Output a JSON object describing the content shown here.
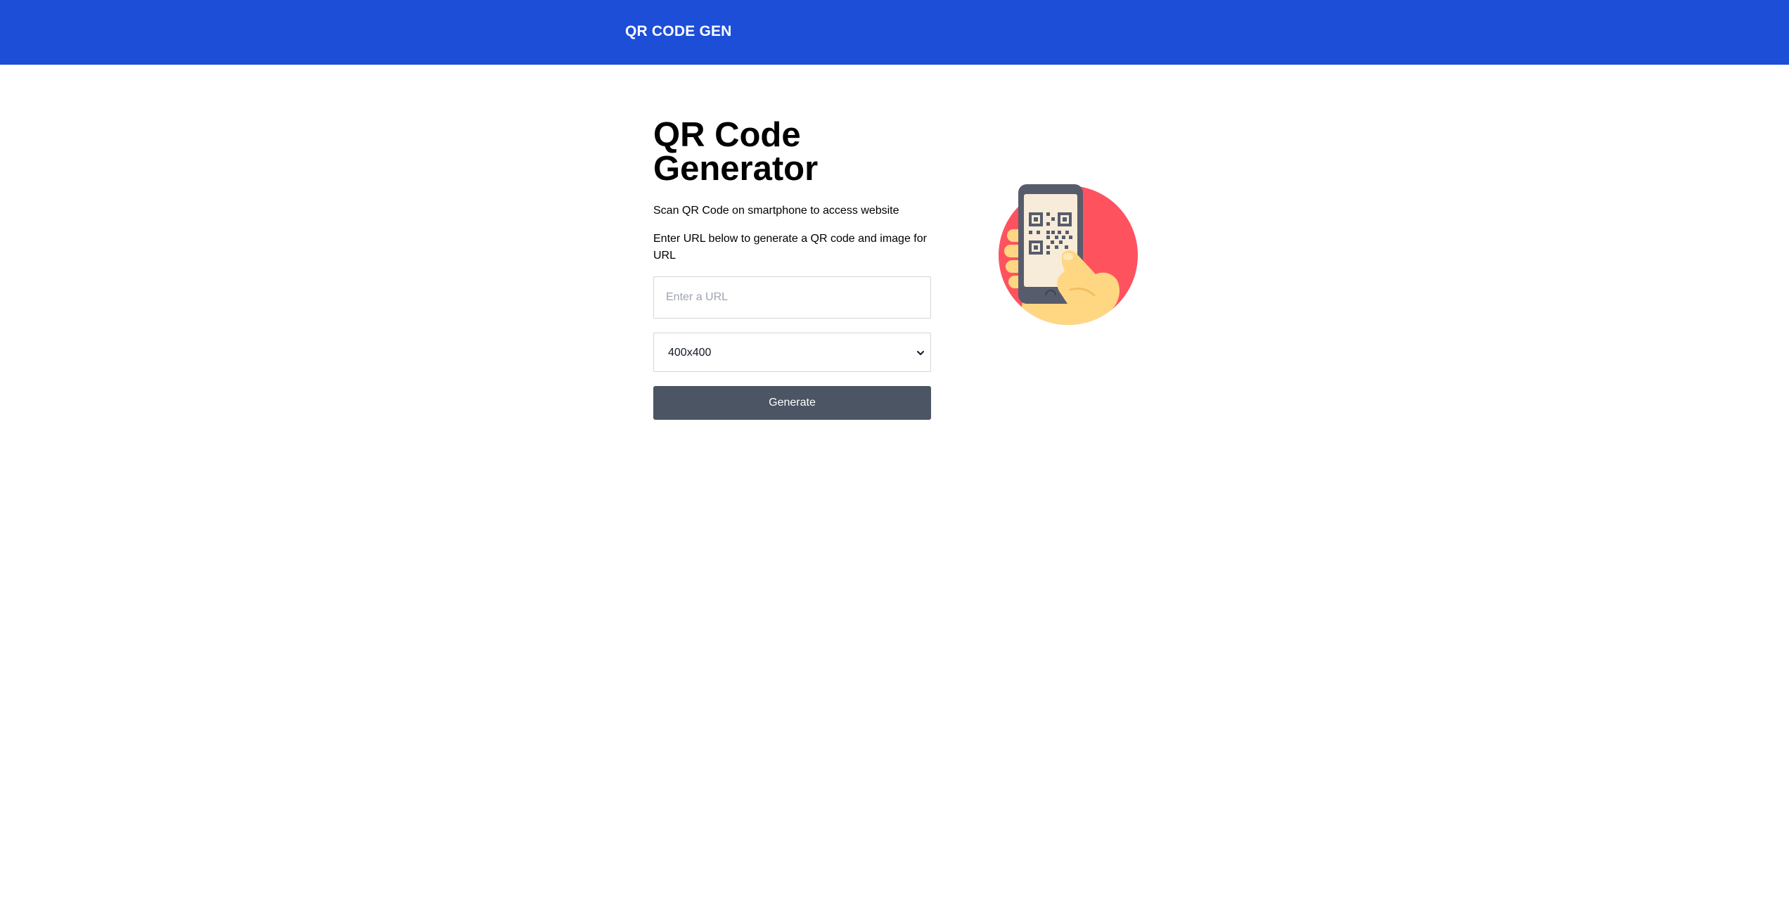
{
  "navbar": {
    "brand": "QR CODE GEN"
  },
  "main": {
    "title_line1": "QR Code",
    "title_line2": "Generator",
    "description_1": "Scan QR Code on smartphone to access website",
    "description_2_line1": "Enter URL below to generate a QR code and image for",
    "description_2_line2": "URL",
    "url_input": {
      "value": "",
      "placeholder": "Enter a URL"
    },
    "size_select": {
      "selected": "400x400"
    },
    "generate_label": "Generate"
  },
  "illustration": {
    "icon": "qr-scan-phone-illustration",
    "colors": {
      "circle": "#ff525f",
      "phone": "#575c6c",
      "screen": "#f7ecd9",
      "hand": "#ffd783"
    }
  },
  "colors": {
    "navbar_bg": "#1d4ed8",
    "button_bg": "#4b5563"
  }
}
